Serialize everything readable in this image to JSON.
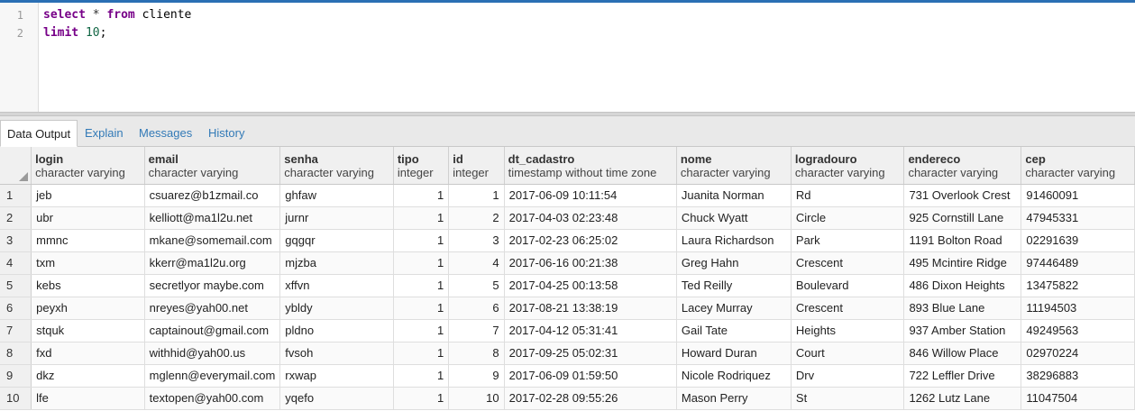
{
  "editor": {
    "lines": [
      {
        "num": "1",
        "kw1": "select",
        "op": " * ",
        "kw2": "from",
        "rest": " cliente"
      },
      {
        "num": "2",
        "kw1": "limit",
        "num_val": "10",
        "end": ";"
      }
    ]
  },
  "tabs": [
    "Data Output",
    "Explain",
    "Messages",
    "History"
  ],
  "grid": {
    "columns": [
      {
        "name": "login",
        "type": "character varying"
      },
      {
        "name": "email",
        "type": "character varying"
      },
      {
        "name": "senha",
        "type": "character varying"
      },
      {
        "name": "tipo",
        "type": "integer"
      },
      {
        "name": "id",
        "type": "integer"
      },
      {
        "name": "dt_cadastro",
        "type": "timestamp without time zone"
      },
      {
        "name": "nome",
        "type": "character varying"
      },
      {
        "name": "logradouro",
        "type": "character varying"
      },
      {
        "name": "endereco",
        "type": "character varying"
      },
      {
        "name": "cep",
        "type": "character varying"
      }
    ],
    "rows": [
      [
        "1",
        "jeb",
        "csuarez@b1zmail.co",
        "ghfaw",
        "1",
        "1",
        "2017-06-09 10:11:54",
        "Juanita Norman",
        "Rd",
        "731 Overlook Crest",
        "91460091"
      ],
      [
        "2",
        "ubr",
        "kelliott@ma1l2u.net",
        "jurnr",
        "1",
        "2",
        "2017-04-03 02:23:48",
        "Chuck Wyatt",
        "Circle",
        "925 Cornstill Lane",
        "47945331"
      ],
      [
        "3",
        "mmnc",
        "mkane@somemail.com",
        "gqgqr",
        "1",
        "3",
        "2017-02-23 06:25:02",
        "Laura Richardson",
        "Park",
        "1191 Bolton Road",
        "02291639"
      ],
      [
        "4",
        "txm",
        "kkerr@ma1l2u.org",
        "mjzba",
        "1",
        "4",
        "2017-06-16 00:21:38",
        "Greg Hahn",
        "Crescent",
        "495 Mcintire Ridge",
        "97446489"
      ],
      [
        "5",
        "kebs",
        "secretlyor maybe.com",
        "xffvn",
        "1",
        "5",
        "2017-04-25 00:13:58",
        "Ted Reilly",
        "Boulevard",
        "486 Dixon Heights",
        "13475822"
      ],
      [
        "6",
        "peyxh",
        "nreyes@yah00.net",
        "ybldy",
        "1",
        "6",
        "2017-08-21 13:38:19",
        "Lacey Murray",
        "Crescent",
        "893 Blue Lane",
        "11194503"
      ],
      [
        "7",
        "stquk",
        "captainout@gmail.com",
        "pldno",
        "1",
        "7",
        "2017-04-12 05:31:41",
        "Gail Tate",
        "Heights",
        "937 Amber Station",
        "49249563"
      ],
      [
        "8",
        "fxd",
        "withhid@yah00.us",
        "fvsoh",
        "1",
        "8",
        "2017-09-25 05:02:31",
        "Howard Duran",
        "Court",
        "846 Willow Place",
        "02970224"
      ],
      [
        "9",
        "dkz",
        "mglenn@everymail.com",
        "rxwap",
        "1",
        "9",
        "2017-06-09 01:59:50",
        "Nicole Rodriquez",
        "Drv",
        "722 Leffler Drive",
        "38296883"
      ],
      [
        "10",
        "lfe",
        "textopen@yah00.com",
        "yqefo",
        "1",
        "10",
        "2017-02-28 09:55:26",
        "Mason Perry",
        "St",
        "1262 Lutz Lane",
        "11047504"
      ]
    ]
  }
}
